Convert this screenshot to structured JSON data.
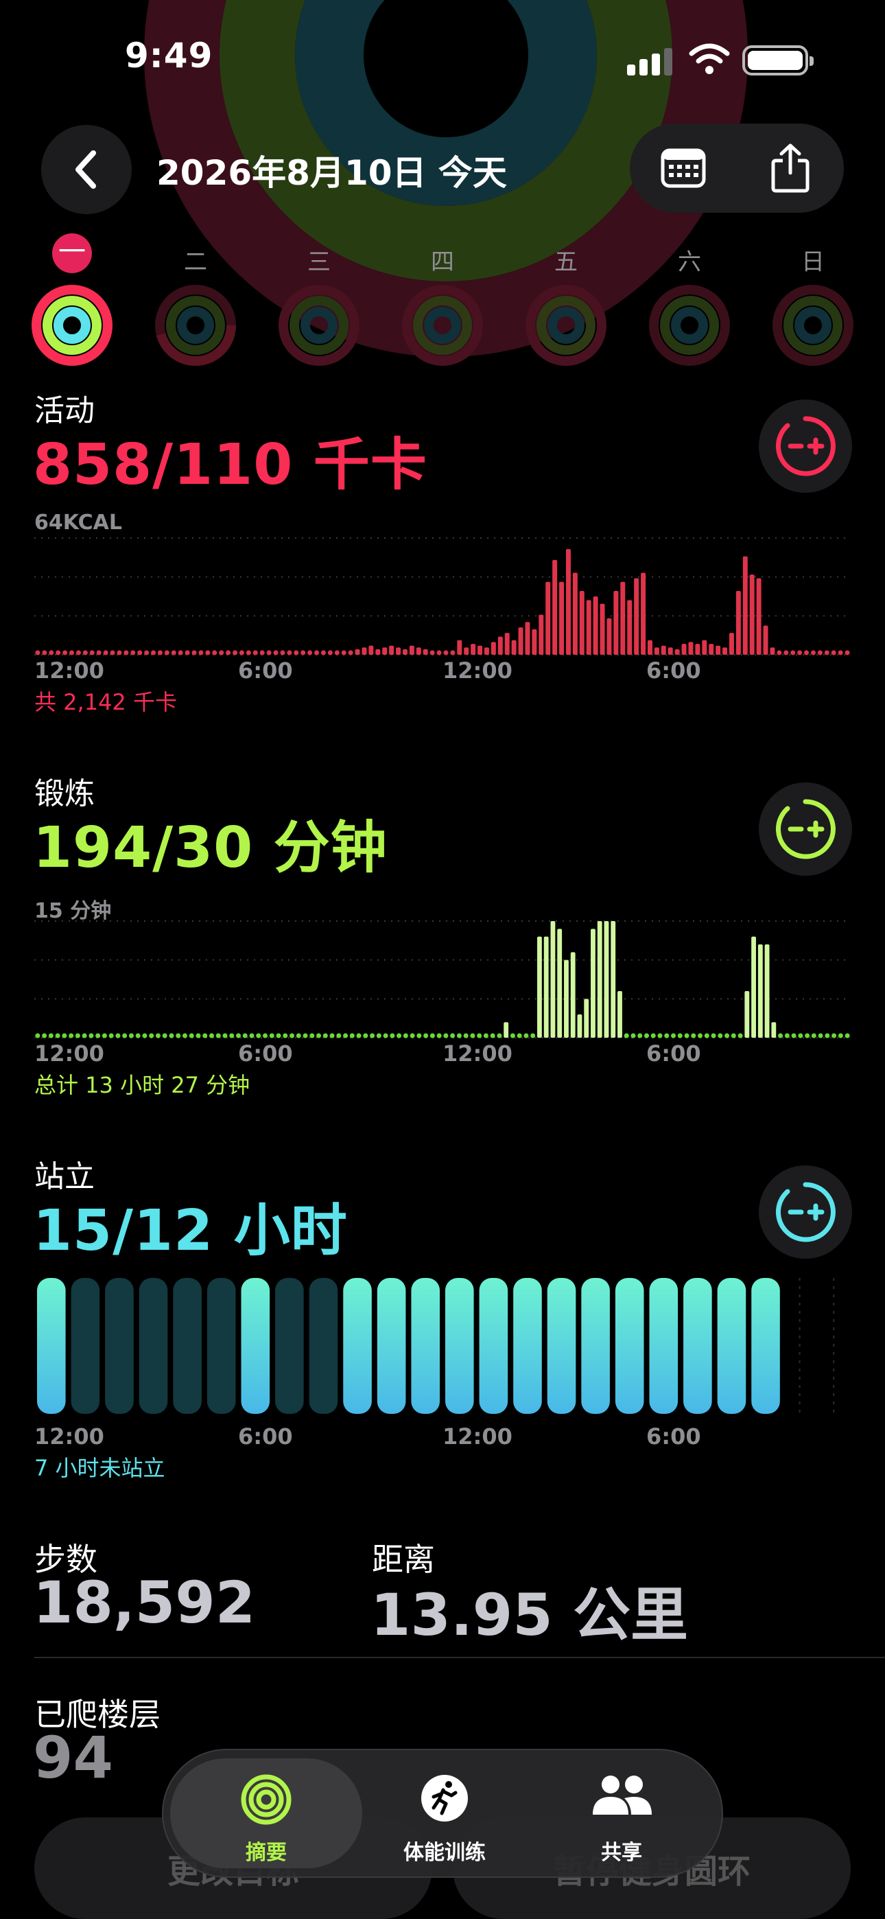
{
  "status_bar": {
    "time": "9:49"
  },
  "header": {
    "title": "2026年8月10日 今天"
  },
  "week": {
    "days": [
      {
        "label": "一",
        "today": true
      },
      {
        "label": "二",
        "today": false
      },
      {
        "label": "三",
        "today": false
      },
      {
        "label": "四",
        "today": false
      },
      {
        "label": "五",
        "today": false
      },
      {
        "label": "六",
        "today": false
      },
      {
        "label": "日",
        "today": false
      }
    ]
  },
  "colors": {
    "move": "#fa2d55",
    "move_bar": "#e0344c",
    "exercise": "#b2f44a",
    "exercise_bar": "#d2f7a0",
    "exercise_dot": "#6ad838",
    "stand": "#5ce3ec",
    "background": "#000000"
  },
  "move": {
    "label": "活动",
    "value": "858/110 千卡",
    "y_label": "64KCAL",
    "total": "共 2,142 千卡",
    "x_ticks": [
      "12:00",
      "6:00",
      "12:00",
      "6:00"
    ]
  },
  "exercise": {
    "label": "锻炼",
    "value": "194/30 分钟",
    "y_label": "15 分钟",
    "total": "总计 13 小时 27 分钟",
    "x_ticks": [
      "12:00",
      "6:00",
      "12:00",
      "6:00"
    ]
  },
  "stand": {
    "label": "站立",
    "value": "15/12 小时",
    "total": "7 小时未站立",
    "x_ticks": [
      "12:00",
      "6:00",
      "12:00",
      "6:00"
    ]
  },
  "stats": {
    "steps": {
      "label": "步数",
      "value": "18,592"
    },
    "distance": {
      "label": "距离",
      "value": "13.95 公里"
    },
    "flights": {
      "label": "已爬楼层",
      "value": "94"
    }
  },
  "bottom_buttons": {
    "change_goals": "更改目标",
    "pause_rings": "暂停健身圆环"
  },
  "tabs": [
    {
      "label": "摘要",
      "icon": "rings-icon",
      "active": true
    },
    {
      "label": "体能训练",
      "icon": "runner-icon",
      "active": false
    },
    {
      "label": "共享",
      "icon": "people-icon",
      "active": false
    }
  ],
  "chart_data": [
    {
      "type": "bar",
      "name": "move-hourly",
      "unit": "KCAL",
      "x_range": [
        "00:00",
        "24:00"
      ],
      "ylim": [
        0,
        64
      ],
      "values": [
        2,
        2,
        2,
        2,
        2,
        2,
        2,
        2,
        2,
        2,
        2,
        2,
        2,
        2,
        2,
        2,
        2,
        2,
        2,
        2,
        2,
        2,
        2,
        2,
        2,
        2,
        2,
        2,
        2,
        2,
        2,
        2,
        2,
        2,
        2,
        2,
        2,
        2,
        2,
        2,
        2,
        2,
        2,
        2,
        2,
        2,
        2,
        3,
        4,
        5,
        3,
        4,
        5,
        4,
        3,
        5,
        4,
        3,
        2,
        2,
        2,
        2,
        8,
        4,
        6,
        5,
        4,
        7,
        10,
        12,
        8,
        15,
        18,
        14,
        22,
        40,
        52,
        40,
        58,
        45,
        35,
        30,
        32,
        28,
        20,
        35,
        40,
        30,
        42,
        45,
        8,
        4,
        5,
        4,
        3,
        6,
        7,
        6,
        8,
        6,
        5,
        4,
        12,
        35,
        54,
        44,
        42,
        16,
        4,
        2,
        2,
        2,
        2,
        2,
        2,
        2,
        2,
        2,
        2,
        2
      ]
    },
    {
      "type": "bar",
      "name": "exercise-hourly",
      "unit": "分钟",
      "x_range": [
        "00:00",
        "24:00"
      ],
      "ylim": [
        0,
        15
      ],
      "values": [
        0.3,
        0.3,
        0.3,
        0.3,
        0.3,
        0.3,
        0.3,
        0.3,
        0.3,
        0.3,
        0.3,
        0.3,
        0.3,
        0.3,
        0.3,
        0.3,
        0.3,
        0.3,
        0.3,
        0.3,
        0.3,
        0.3,
        0.3,
        0.3,
        0.3,
        0.3,
        0.3,
        0.3,
        0.3,
        0.3,
        0.3,
        0.3,
        0.3,
        0.3,
        0.3,
        0.3,
        0.3,
        0.3,
        0.3,
        0.3,
        0.3,
        0.3,
        0.3,
        0.3,
        0.3,
        0.3,
        0.3,
        0.3,
        0.3,
        0.3,
        0.3,
        0.3,
        0.3,
        0.3,
        0.3,
        0.3,
        0.3,
        0.3,
        0.3,
        0.3,
        0.3,
        0.3,
        0.3,
        0.3,
        0.3,
        0.3,
        0.3,
        0.3,
        0.3,
        0.3,
        2,
        0.3,
        0.3,
        0.3,
        0.3,
        13,
        13,
        15,
        14,
        10,
        11,
        3,
        5,
        14,
        15,
        15,
        15,
        6,
        0.3,
        0.3,
        0.3,
        0.3,
        0.3,
        0.3,
        0.3,
        0.3,
        0.3,
        0.3,
        0.3,
        0.3,
        0.3,
        0.3,
        0.3,
        0.3,
        0.3,
        0.3,
        6,
        13,
        12,
        12,
        2,
        0.3,
        0.3,
        0.3,
        0.3,
        0.3,
        0.3,
        0.3,
        0.3,
        0.3,
        0.3,
        0.3
      ]
    },
    {
      "type": "bar",
      "name": "stand-hourly",
      "x_range": [
        "00:00",
        "24:00"
      ],
      "values": [
        1,
        0,
        0,
        0,
        0,
        0,
        1,
        0,
        0,
        1,
        1,
        1,
        1,
        1,
        1,
        1,
        1,
        1,
        1,
        1,
        1,
        1,
        -1,
        -1
      ]
    }
  ]
}
